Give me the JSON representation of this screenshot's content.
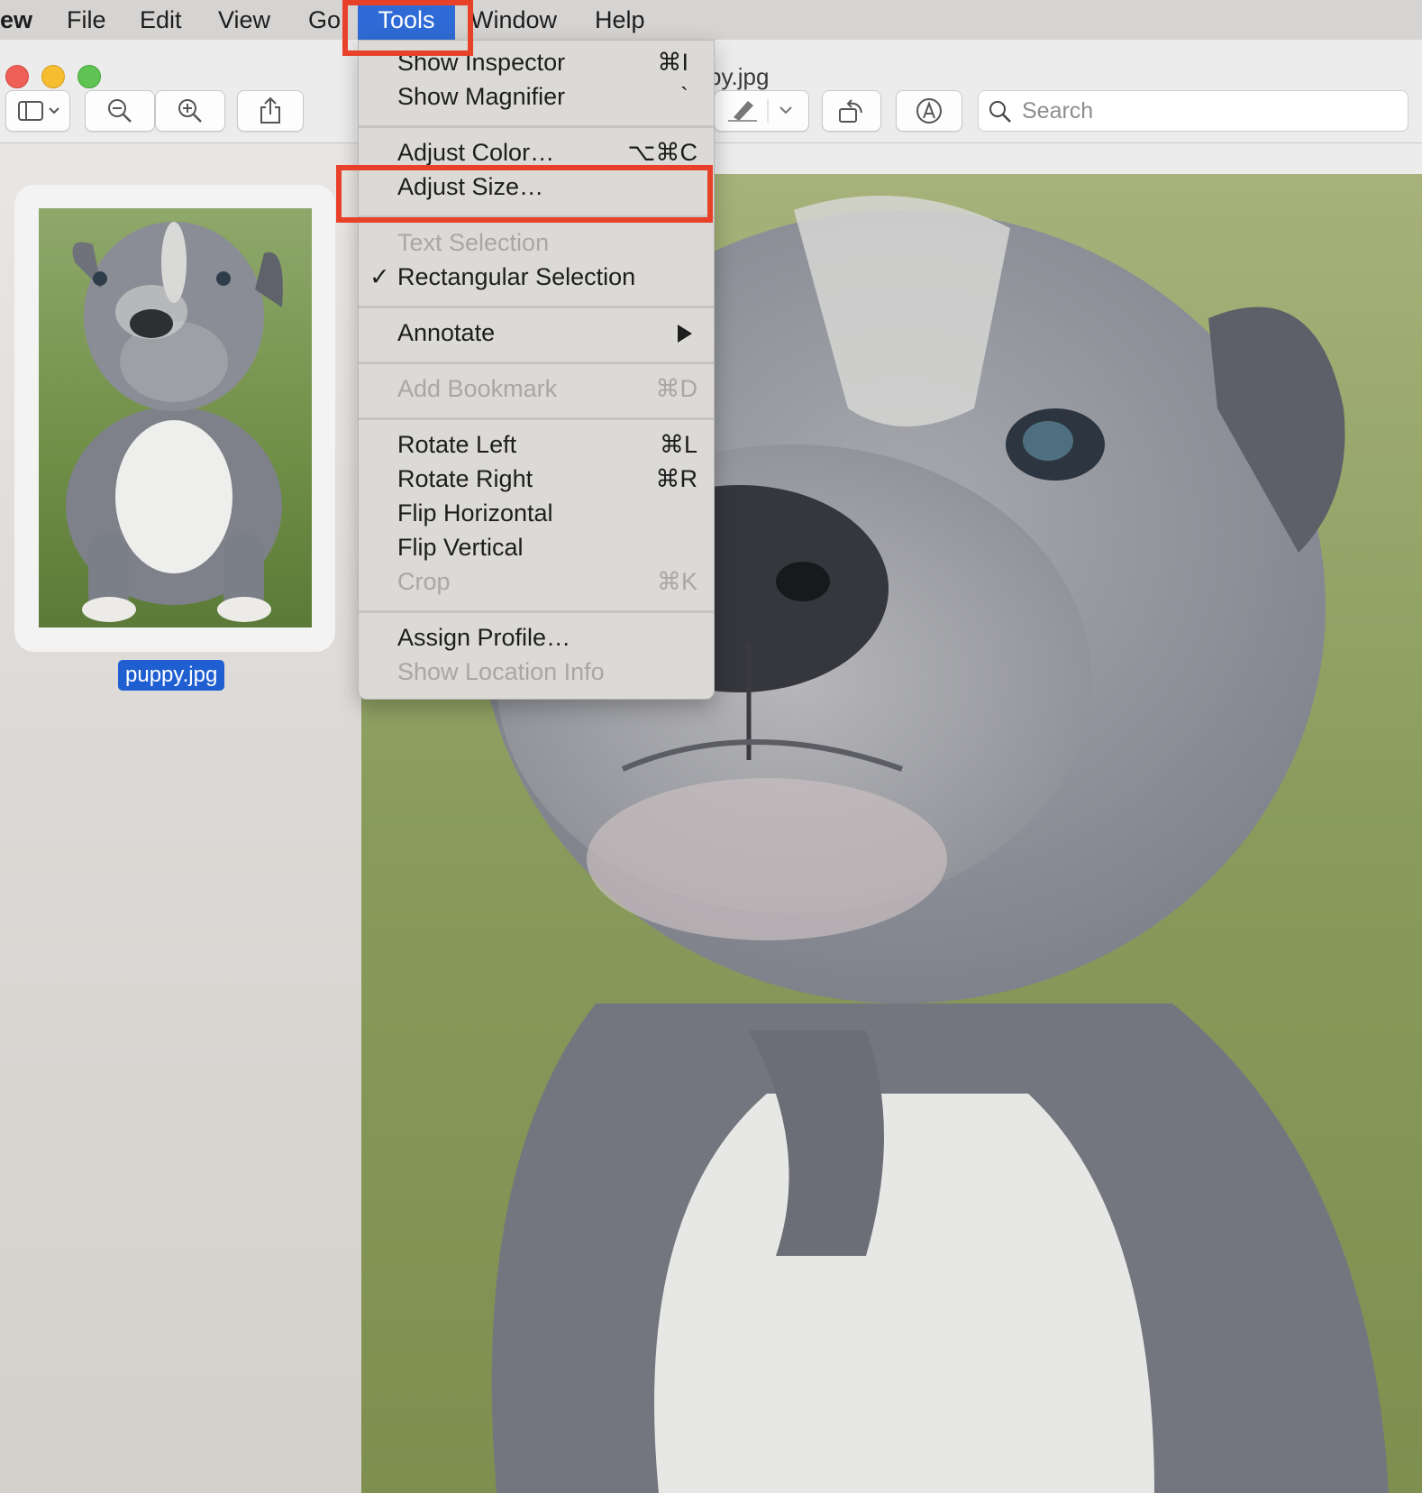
{
  "menubar": {
    "app_partial": "ew",
    "items": [
      "File",
      "Edit",
      "View",
      "Go",
      "Tools",
      "Window",
      "Help"
    ]
  },
  "window": {
    "title_partial": "py.jpg",
    "search_placeholder": "Search"
  },
  "sidebar": {
    "thumbnail_label": "puppy.jpg"
  },
  "tools_menu": {
    "items": [
      {
        "label": "Show Inspector",
        "shortcut": "⌘I",
        "enabled": true
      },
      {
        "label": "Show Magnifier",
        "shortcut": "`",
        "enabled": true
      },
      {
        "label": "Adjust Color…",
        "shortcut": "⌥⌘C",
        "enabled": true
      },
      {
        "label": "Adjust Size…",
        "shortcut": "",
        "enabled": true,
        "highlighted_annotation": true
      },
      {
        "label": "Text Selection",
        "shortcut": "",
        "enabled": false
      },
      {
        "label": "Rectangular Selection",
        "shortcut": "",
        "enabled": true,
        "checked": true
      },
      {
        "label": "Annotate",
        "shortcut": "",
        "enabled": true,
        "submenu": true
      },
      {
        "label": "Add Bookmark",
        "shortcut": "⌘D",
        "enabled": false
      },
      {
        "label": "Rotate Left",
        "shortcut": "⌘L",
        "enabled": true
      },
      {
        "label": "Rotate Right",
        "shortcut": "⌘R",
        "enabled": true
      },
      {
        "label": "Flip Horizontal",
        "shortcut": "",
        "enabled": true
      },
      {
        "label": "Flip Vertical",
        "shortcut": "",
        "enabled": true
      },
      {
        "label": "Crop",
        "shortcut": "⌘K",
        "enabled": false
      },
      {
        "label": "Assign Profile…",
        "shortcut": "",
        "enabled": true
      },
      {
        "label": "Show Location Info",
        "shortcut": "",
        "enabled": false
      }
    ]
  },
  "colors": {
    "accent": "#2f6bd6",
    "annotation": "#e8412a"
  }
}
